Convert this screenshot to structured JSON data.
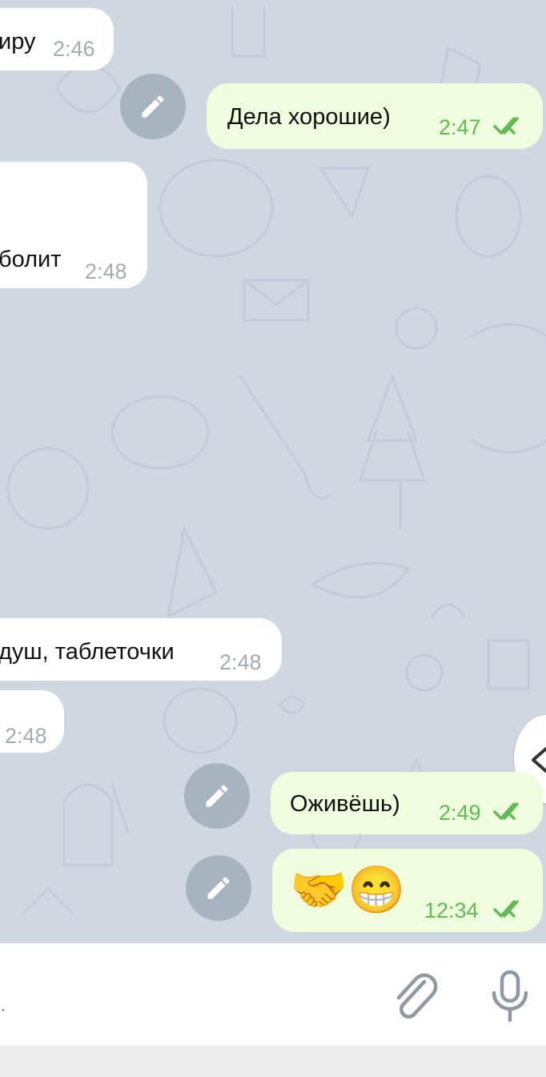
{
  "messages": [
    {
      "id": "m1",
      "dir": "in",
      "text": "иру",
      "time": "2:46"
    },
    {
      "id": "m2",
      "dir": "out",
      "text": "Дела хорошие)",
      "time": "2:47"
    },
    {
      "id": "m3",
      "dir": "in",
      "text": "болит",
      "time": "2:48"
    },
    {
      "id": "m4",
      "dir": "in",
      "text": "душ, таблеточки",
      "time": "2:48"
    },
    {
      "id": "m5",
      "dir": "in",
      "text": "",
      "time": "2:48"
    },
    {
      "id": "m6",
      "dir": "out",
      "text": "Оживёшь)",
      "time": "2:49"
    },
    {
      "id": "m7",
      "dir": "out",
      "text": "🤝😁",
      "time": "12:34"
    }
  ],
  "input": {
    "placeholder": "."
  },
  "colors": {
    "chat_background": "#cfd8e1",
    "incoming_bubble": "#ffffff",
    "outgoing_bubble": "#effdde",
    "outgoing_time": "#5fbb53",
    "incoming_time": "#a2acb4",
    "edit_button": "#a7b3bf"
  },
  "icons": [
    "pencil-icon",
    "double-check-icon",
    "chevron-left-icon",
    "paperclip-icon",
    "microphone-icon"
  ]
}
